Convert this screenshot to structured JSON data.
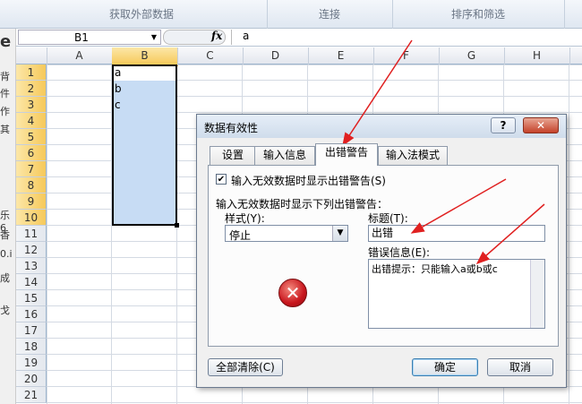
{
  "ribbon": {
    "groups": [
      "获取外部数据",
      "连接",
      "排序和筛选"
    ]
  },
  "left_fragments": [
    "e",
    "背",
    "件",
    "作",
    "其",
    "乐6",
    "香",
    "0.i",
    "成",
    "戈"
  ],
  "formula_bar": {
    "name_box": "B1",
    "fx_label": "fx",
    "value": "a"
  },
  "columns": [
    "A",
    "B",
    "C",
    "D",
    "E",
    "F",
    "G",
    "H"
  ],
  "rows": [
    "1",
    "2",
    "3",
    "4",
    "5",
    "6",
    "7",
    "8",
    "9",
    "10",
    "11",
    "12",
    "13",
    "14",
    "15",
    "16",
    "17",
    "18",
    "19",
    "20",
    "21"
  ],
  "cells": {
    "b1": "a",
    "b2": "b",
    "b3": "c"
  },
  "dialog": {
    "title": "数据有效性",
    "help_label": "?",
    "close_label": "✕",
    "tabs": [
      "设置",
      "输入信息",
      "出错警告",
      "输入法模式"
    ],
    "active_tab": "出错警告",
    "show_alert_label": "输入无效数据时显示出错警告(S)",
    "show_alert_checked": true,
    "section_label": "输入无效数据时显示下列出错警告：",
    "style_label": "样式(Y):",
    "style_value": "停止",
    "title_label": "标题(T):",
    "title_value": "出错",
    "message_label": "错误信息(E):",
    "message_value": "出错提示：只能输入a或b或c",
    "error_icon": "error-stop-icon",
    "clear_all_label": "全部清除(C)",
    "ok_label": "确定",
    "cancel_label": "取消"
  },
  "colors": {
    "annotation_arrow": "#e02020",
    "selection": "#c7dcf4",
    "header_highlight": "#f6c95a"
  }
}
